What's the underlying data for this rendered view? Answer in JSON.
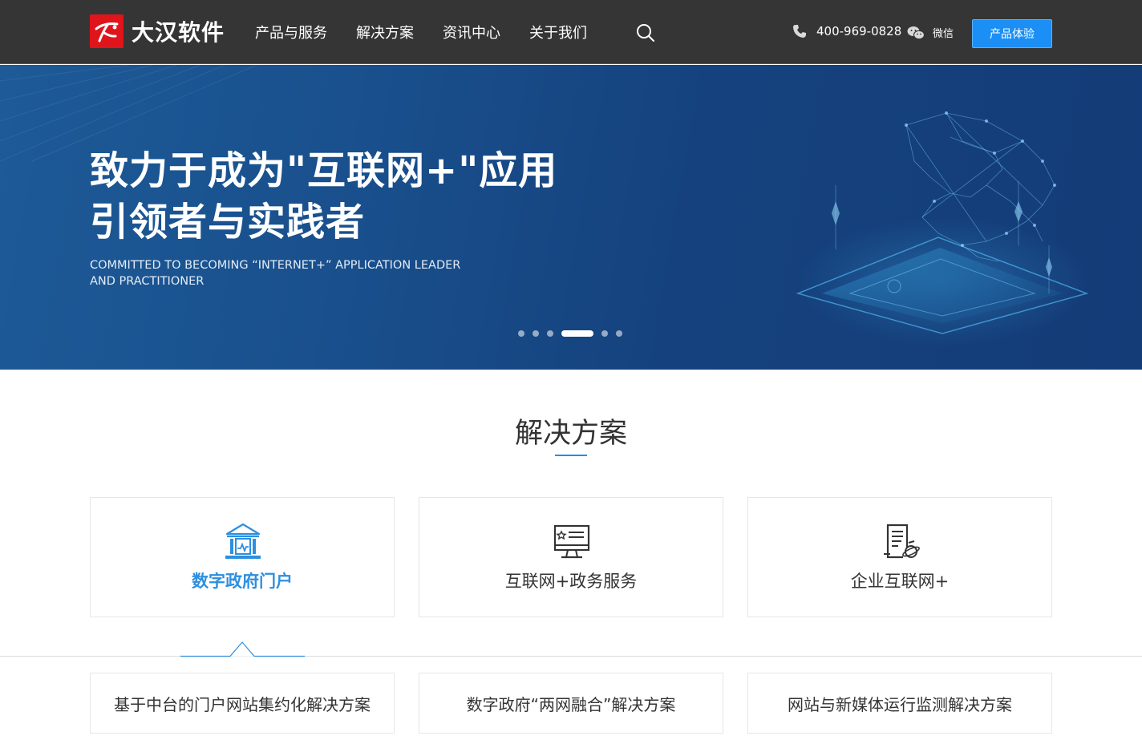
{
  "header": {
    "logo_text": "大汉软件",
    "nav": [
      "产品与服务",
      "解决方案",
      "资讯中心",
      "关于我们"
    ],
    "phone": "400-969-0828",
    "wechat_label": "微信",
    "cta_label": "产品体验",
    "logo_color": "#e0141b",
    "cta_color": "#1b8ff5"
  },
  "banner": {
    "title_line1": "致力于成为\"互联网+\"应用",
    "title_line2": "引领者与实践者",
    "subtitle_line1": "COMMITTED TO BECOMING “INTERNET+” APPLICATION LEADER",
    "subtitle_line2": "AND PRACTITIONER",
    "slide_count": 6,
    "active_slide_index": 3
  },
  "solutions": {
    "section_title": "解决方案",
    "accent_color": "#1b8ff5",
    "cards": [
      {
        "label": "数字政府门户",
        "icon": "government-building-icon",
        "active": true
      },
      {
        "label": "互联网+政务服务",
        "icon": "monitor-dashboard-icon",
        "active": false
      },
      {
        "label": "企业互联网+",
        "icon": "document-globe-icon",
        "active": false
      }
    ],
    "sub_items": [
      "基于中台的门户网站集约化解决方案",
      "数字政府“两网融合”解决方案",
      "网站与新媒体运行监测解决方案"
    ]
  }
}
